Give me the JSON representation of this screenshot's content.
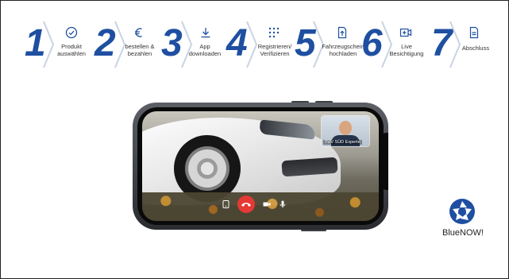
{
  "steps": [
    {
      "number": "1",
      "icon": "check-circle-icon",
      "label": "Produkt\nauswählen"
    },
    {
      "number": "2",
      "icon": "euro-icon",
      "label": "bestellen &\nbezahlen"
    },
    {
      "number": "3",
      "icon": "download-icon",
      "label": "App\ndownloaden"
    },
    {
      "number": "4",
      "icon": "dots-grid-icon",
      "label": "Registrieren/\nVerifizieren"
    },
    {
      "number": "5",
      "icon": "upload-document-icon",
      "label": "Fahrzeugschein\nhochladen"
    },
    {
      "number": "6",
      "icon": "video-add-icon",
      "label": "Live\nBesichtigung"
    },
    {
      "number": "7",
      "icon": "document-icon",
      "label": "Abschluss"
    }
  ],
  "video_call": {
    "participant_name": "TÜV SÜD Experte"
  },
  "brand": {
    "name": "BlueNOW!",
    "primary_color": "#1e4fa1",
    "end_call_color": "#e53935"
  }
}
